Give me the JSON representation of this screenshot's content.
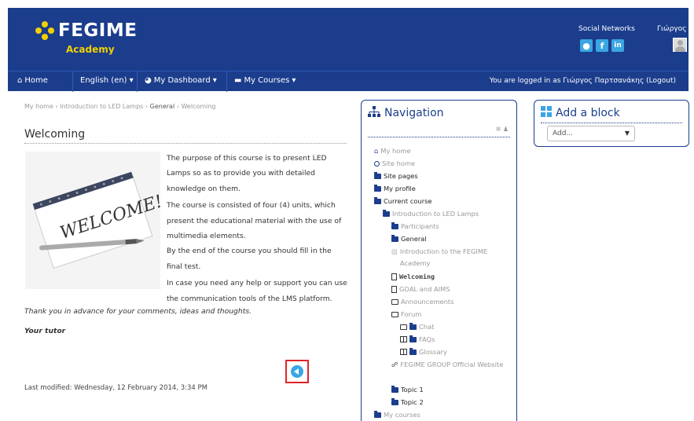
{
  "header": {
    "brand": "FEGIME",
    "sub": "Academy",
    "social_label": "Social Networks",
    "social_icons": [
      "globe-icon",
      "facebook-icon",
      "linkedin-icon"
    ],
    "user_name": "Γιώργος",
    "accent": "#1b3d8c"
  },
  "navbar": {
    "home": "Home",
    "language": "English (en)",
    "dashboard": "My Dashboard",
    "courses": "My Courses",
    "logged_in": "You are logged in as Γιώργος Παρτσανάκης (Logout)"
  },
  "breadcrumb": {
    "items": [
      "My home",
      "Introduction to LED Lamps",
      "General",
      "Welcoming"
    ],
    "sep": " › "
  },
  "page": {
    "title": "Welcoming",
    "image_text": "WELCOME!",
    "paragraphs": [
      "The purpose of this course is to present LED Lamps so as to provide you with detailed knowledge on them.",
      "The course is consisted of four (4) units, which present the educational material with the use of multimedia elements.",
      "By the end of the course you should fill in the final test.",
      "In case you need any help or support you can use the communication tools of the LMS platform."
    ],
    "thanks": "Thank you in advance for your comments, ideas and thoughts.",
    "signature": "Your tutor",
    "modified": "Last modified: Wednesday, 12 February 2014, 3:34 PM"
  },
  "navigation": {
    "title": "Navigation",
    "items": [
      "My home",
      "Site home",
      "Site pages",
      "My profile",
      "Current course",
      "Introduction to LED Lamps",
      "Participants",
      "General",
      "Introduction to the FEGIME Academy",
      "Welcoming",
      "GOAL and AIMS",
      "Announcements",
      "Forum",
      "Chat",
      "FAQs",
      "Glossary",
      "FEGIME GROUP Official Website",
      "Topic 1",
      "Topic 2",
      "My courses"
    ]
  },
  "add_block": {
    "title": "Add a block",
    "select_value": "Add..."
  }
}
